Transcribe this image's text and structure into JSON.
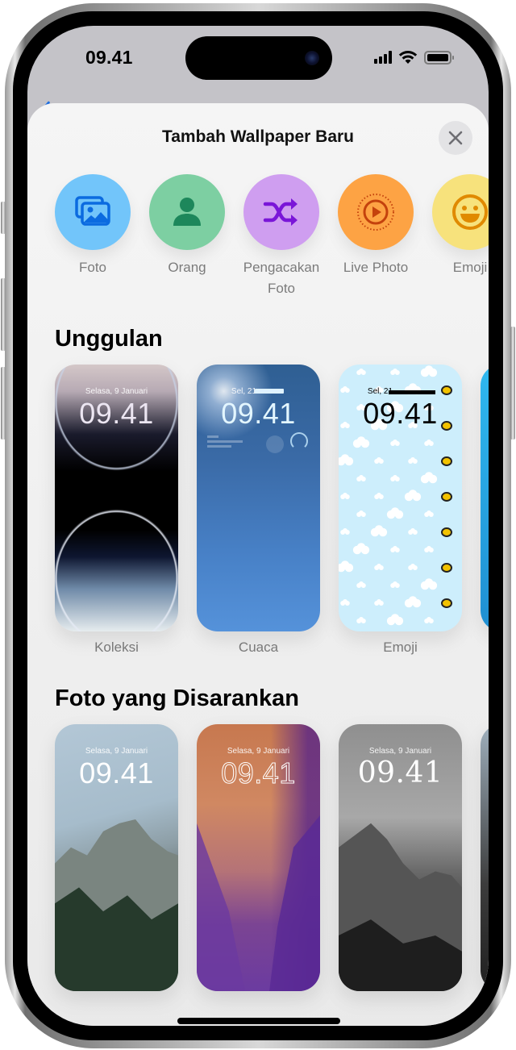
{
  "status_bar": {
    "time": "09.41",
    "icons": [
      "cellular-signal-icon",
      "wifi-icon",
      "battery-icon"
    ]
  },
  "sheet": {
    "title": "Tambah Wallpaper Baru",
    "close_icon": "close-icon"
  },
  "categories": [
    {
      "label": "Foto",
      "icon": "photos-icon",
      "color": "#72c5fa",
      "icon_color": "#0b6be0"
    },
    {
      "label": "Orang",
      "icon": "person-icon",
      "color": "#7dcfa2",
      "icon_color": "#1d875b"
    },
    {
      "label": "Pengacakan Foto",
      "icon": "shuffle-icon",
      "color": "#cf9ef0",
      "icon_color": "#7a16d8"
    },
    {
      "label": "Live Photo",
      "icon": "live-photo-icon",
      "color": "#fda344",
      "icon_color": "#c4420d"
    },
    {
      "label": "Emoji",
      "icon": "emoji-icon",
      "color": "#f7e27c",
      "icon_color": "#e08a00"
    }
  ],
  "featured": {
    "title": "Unggulan",
    "cards": [
      {
        "label": "Koleksi",
        "date": "Selasa, 9 Januari",
        "time": "09.41"
      },
      {
        "label": "Cuaca",
        "date": "Sel, 21",
        "time": "09.41"
      },
      {
        "label": "Emoji",
        "date": "Sel, 21",
        "time": "09.41"
      }
    ]
  },
  "suggested": {
    "title": "Foto yang Disarankan",
    "cards": [
      {
        "date": "Selasa, 9 Januari",
        "time": "09.41"
      },
      {
        "date": "Selasa, 9 Januari",
        "time": "09.41"
      },
      {
        "date": "Selasa, 9 Januari",
        "time": "09.41"
      }
    ]
  }
}
